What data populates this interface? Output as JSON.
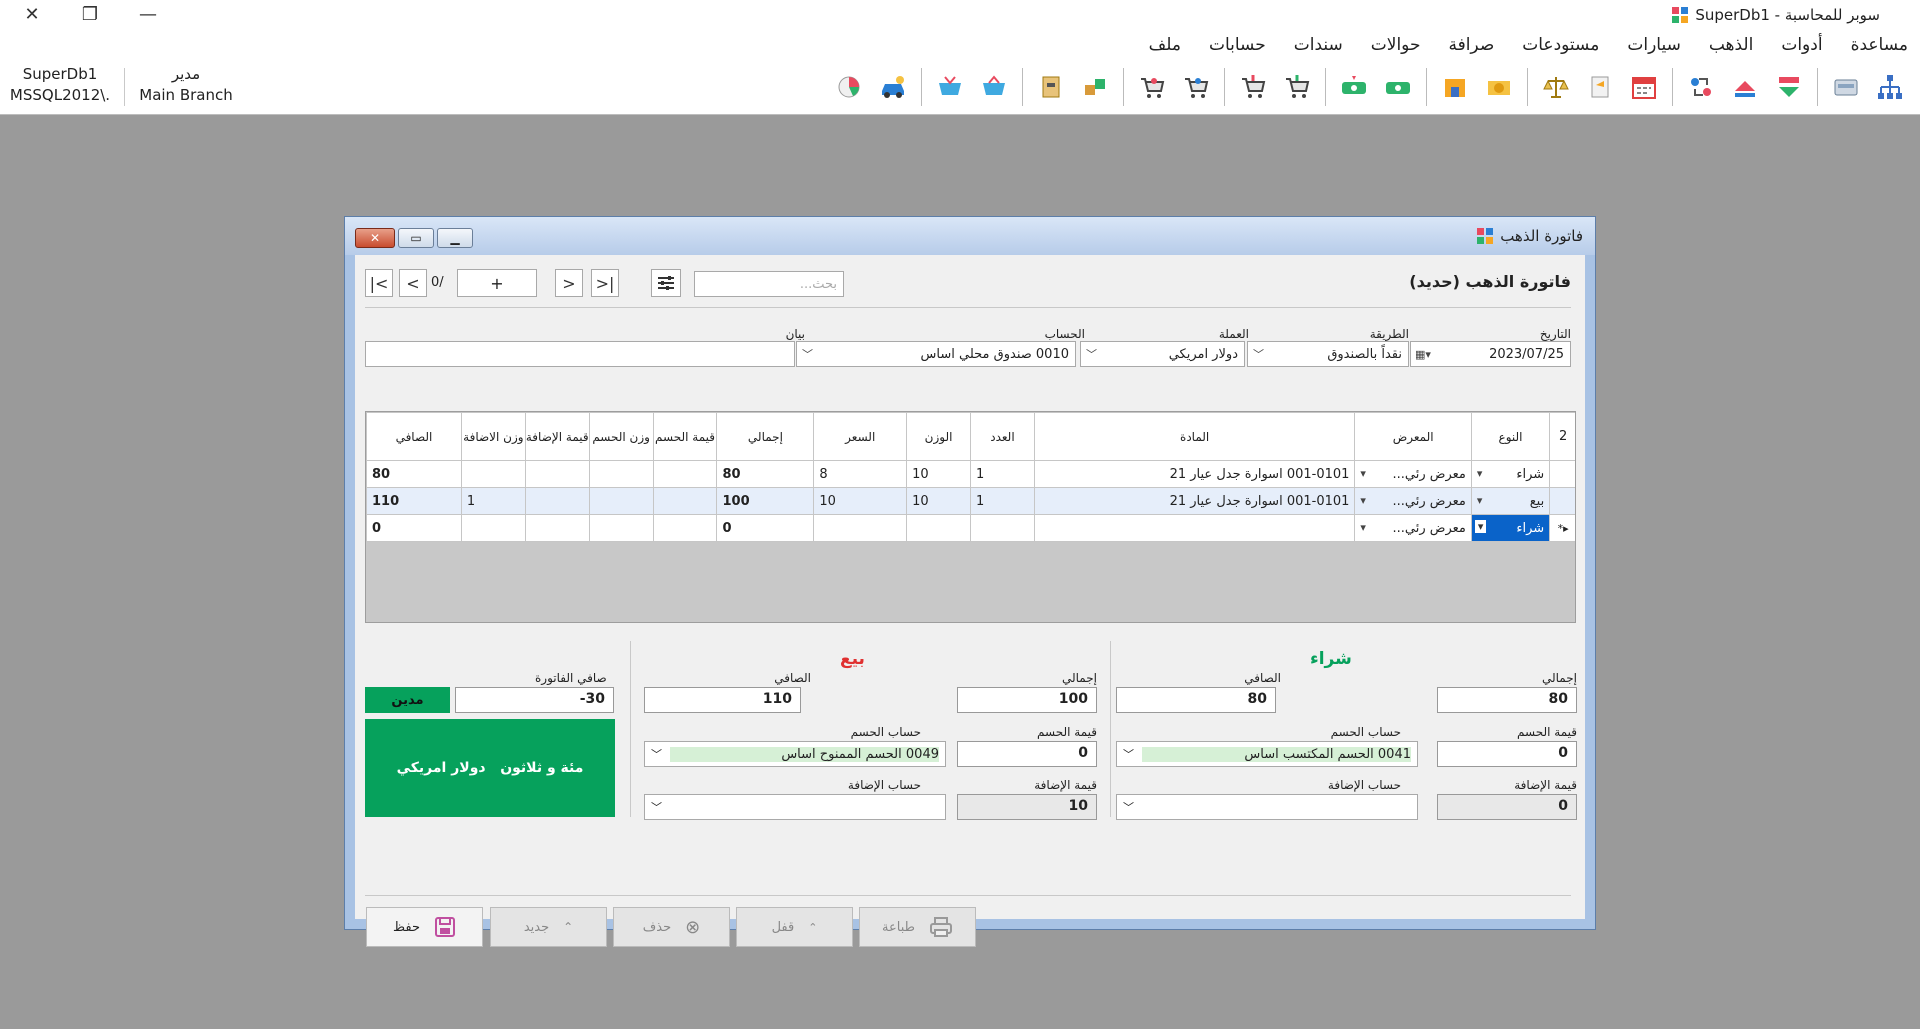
{
  "app": {
    "title": "سوبر للمحاسبة - SuperDb1"
  },
  "menu": [
    "ملف",
    "حسابات",
    "سندات",
    "حوالات",
    "صرافة",
    "مستودعات",
    "سيارات",
    "الذهب",
    "أدوات",
    "مساعدة"
  ],
  "info": {
    "db": "SuperDb1",
    "server": "MSSQL2012\\.",
    "user": "مدير",
    "branch": "Main Branch"
  },
  "toolbar_icons": [
    "tree-icon",
    "scanner-icon",
    "receive-icon",
    "pay-icon",
    "transfer-icon",
    "calendar-icon",
    "stamp-icon",
    "scale-icon",
    "money-envelope-icon",
    "store-icon",
    "cash-in-icon",
    "cash-out-icon",
    "cart-in-icon",
    "cart-out-icon",
    "cart-return-icon",
    "cart-return2-icon",
    "boxes-in-icon",
    "boxes-out-icon",
    "basket-in-icon",
    "basket-out-icon",
    "car-icon",
    "chart-icon"
  ],
  "win": {
    "title": "فاتورة الذهب",
    "heading": "فاتورة الذهب (حديد)",
    "nav": {
      "add_label": "+",
      "count": "0/",
      "search_placeholder": "بحث..."
    },
    "fields": {
      "date_label": "التاريخ",
      "date": "2023/07/25",
      "method_label": "الطريقة",
      "method": "نقداً بالصندوق",
      "currency_label": "العملة",
      "currency": "دولار امريكي",
      "account_label": "الحساب",
      "account": "0010 صندوق محلي اساس",
      "note_label": "بيان",
      "note": ""
    },
    "grid": {
      "count": "2",
      "headers": [
        "النوع",
        "المعرض",
        "المادة",
        "العدد",
        "الوزن",
        "السعر",
        "إجمالي",
        "قيمة الحسم",
        "وزن الحسم",
        "قيمة الإضافة",
        "وزن الاضافة",
        "الصافي"
      ],
      "rows": [
        {
          "type": "شراء",
          "gallery": "معرض رئي...",
          "item": "001-0101 اسوارة جدل عيار 21",
          "qty": "1",
          "weight": "10",
          "price": "8",
          "total": "80",
          "disc_val": "",
          "disc_w": "",
          "add_val": "",
          "add_w": "",
          "net": "80"
        },
        {
          "type": "بيع",
          "gallery": "معرض رئي...",
          "item": "001-0101 اسوارة جدل عيار 21",
          "qty": "1",
          "weight": "10",
          "price": "10",
          "total": "100",
          "disc_val": "",
          "disc_w": "",
          "add_val": "",
          "add_w": "1",
          "net": "110"
        },
        {
          "type": "شراء",
          "gallery": "معرض رئي...",
          "item": "",
          "qty": "",
          "weight": "",
          "price": "",
          "total": "0",
          "disc_val": "",
          "disc_w": "",
          "add_val": "",
          "add_w": "",
          "net": "0"
        }
      ]
    },
    "buy": {
      "title": "شراء",
      "total_label": "إجمالي",
      "total": "80",
      "net_label": "الصافي",
      "net": "80",
      "disc_val_label": "قيمة الحسم",
      "disc_val": "0",
      "disc_acc_label": "حساب الحسم",
      "disc_acc": "0041 الحسم المكتسب اساس",
      "add_val_label": "قيمة الإضافة",
      "add_val": "0",
      "add_acc_label": "حساب الإضافة",
      "add_acc": ""
    },
    "sell": {
      "title": "بيع",
      "total_label": "إجمالي",
      "total": "100",
      "net_label": "الصافي",
      "net": "110",
      "disc_val_label": "قيمة الحسم",
      "disc_val": "0",
      "disc_acc_label": "حساب الحسم",
      "disc_acc": "0049 الحسم الممنوح اساس",
      "add_val_label": "قيمة الإضافة",
      "add_val": "10",
      "add_acc_label": "حساب الإضافة",
      "add_acc": ""
    },
    "summary": {
      "net_label": "صافي الفاتورة",
      "net": "-30",
      "status": "مدين",
      "words": "مئة و ثلاثون   دولار امريكي"
    },
    "buttons": {
      "save": "حفظ",
      "new": "جديد",
      "delete": "حذف",
      "lock": "قفل",
      "print": "طباعة"
    },
    "colors": {
      "green": "#06a15c",
      "red": "#e03030",
      "selection": "#0a63c9"
    }
  }
}
